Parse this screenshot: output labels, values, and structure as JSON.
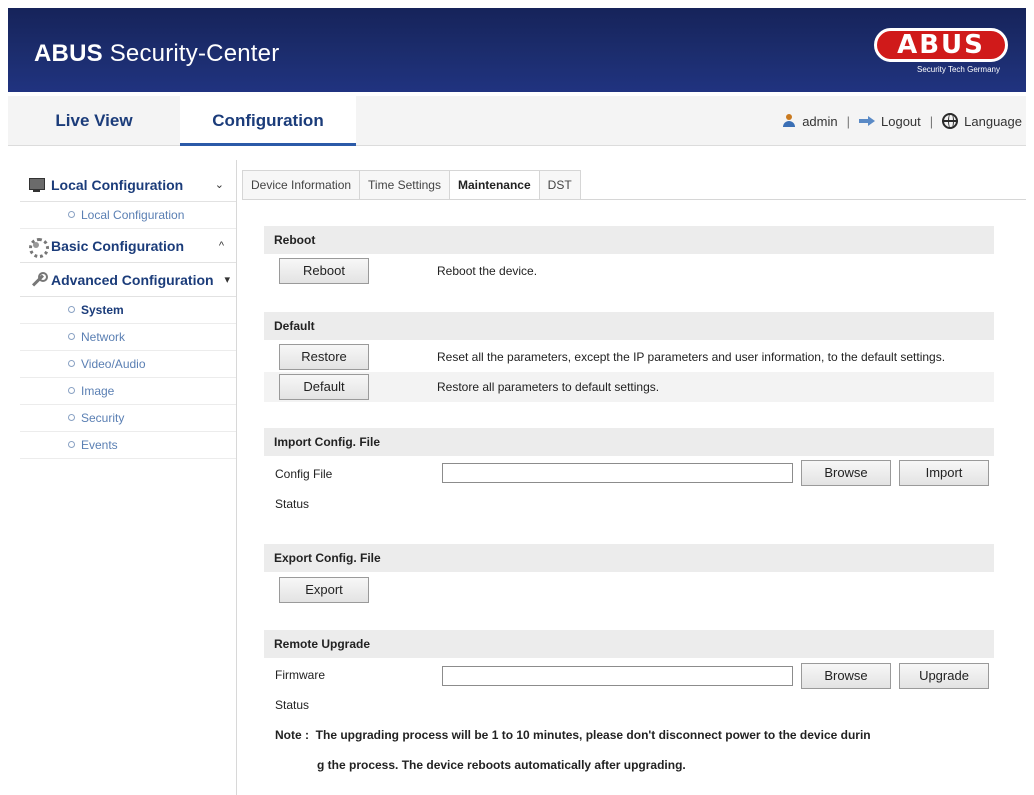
{
  "header": {
    "brand_bold": "ABUS",
    "brand_rest": "Security-Center",
    "logo_text": "ABUS",
    "logo_tagline": "Security Tech Germany"
  },
  "topnav": {
    "tabs": [
      "Live View",
      "Configuration"
    ],
    "user": "admin",
    "logout": "Logout",
    "language": "Language",
    "separator": "|"
  },
  "sidebar": {
    "local_title": "Local Configuration",
    "local_items": [
      "Local Configuration"
    ],
    "basic_title": "Basic Configuration",
    "advanced_title": "Advanced Configuration",
    "advanced_items": [
      "System",
      "Network",
      "Video/Audio",
      "Image",
      "Security",
      "Events"
    ],
    "chev_down": "⌄",
    "chev_up": "^",
    "chev_adv": "▾"
  },
  "tabs": [
    "Device Information",
    "Time Settings",
    "Maintenance",
    "DST"
  ],
  "reboot": {
    "title": "Reboot",
    "button": "Reboot",
    "desc": "Reboot the device."
  },
  "default": {
    "title": "Default",
    "restore_button": "Restore",
    "restore_desc": "Reset all the parameters, except the IP parameters and user information, to the default settings.",
    "default_button": "Default",
    "default_desc": "Restore all parameters to default settings."
  },
  "import": {
    "title": "Import Config. File",
    "file_label": "Config File",
    "file_value": "",
    "browse": "Browse",
    "action": "Import",
    "status_label": "Status"
  },
  "export": {
    "title": "Export Config. File",
    "button": "Export"
  },
  "upgrade": {
    "title": "Remote Upgrade",
    "file_label": "Firmware",
    "file_value": "",
    "browse": "Browse",
    "action": "Upgrade",
    "status_label": "Status",
    "note_line1": "Note :  The upgrading process will be 1 to 10 minutes, please don't disconnect power to the device durin",
    "note_line2": "g the process. The device reboots automatically after upgrading."
  },
  "colors": {
    "banner": "#1c2d6e",
    "logo_red": "#d01a1a",
    "nav_text": "#1b3c7a",
    "link": "#5a7fb3"
  }
}
